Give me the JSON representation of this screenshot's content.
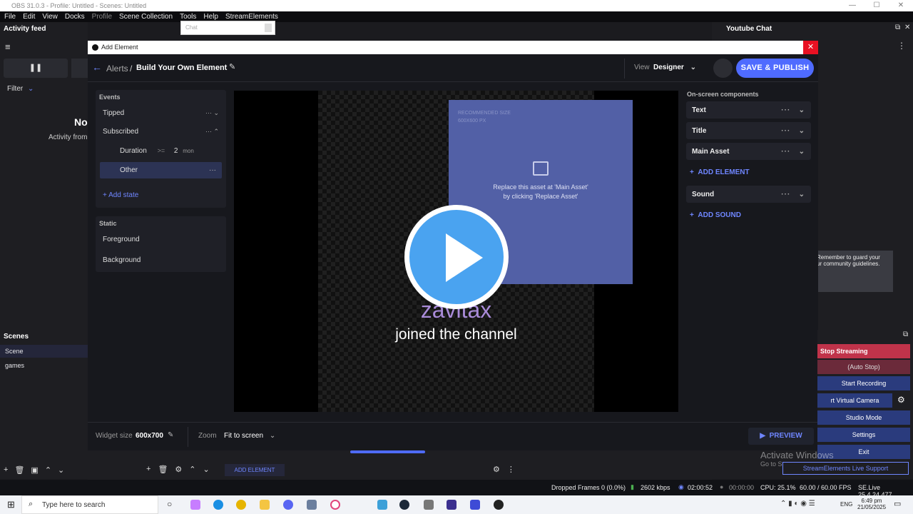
{
  "window": {
    "title": "OBS 31.0.3 - Profile: Untitled - Scenes: Untitled"
  },
  "menu": [
    "File",
    "Edit",
    "View",
    "Docks",
    "Profile",
    "Scene Collection",
    "Tools",
    "Help",
    "StreamElements"
  ],
  "chat_popup": {
    "label": "Chat"
  },
  "activity": {
    "title": "Activity feed",
    "filter": "Filter",
    "empty_title": "No",
    "empty_sub": "Activity from"
  },
  "youtube": {
    "title": "Youtube Chat",
    "notice_line1": "Remember to guard your",
    "notice_line2": "ur community guidelines."
  },
  "modal": {
    "title": "Add Element",
    "breadcrumb_parent": "Alerts",
    "breadcrumb_sep": "/",
    "breadcrumb_current": "Build Your Own Element",
    "view_label": "View",
    "view_value": "Designer",
    "publish": "SAVE & PUBLISH"
  },
  "events": {
    "heading": "Events",
    "items": [
      {
        "label": "Tipped",
        "ctl": "··· ⌄"
      },
      {
        "label": "Subscribed",
        "ctl": "··· ⌃"
      }
    ],
    "duration": {
      "label": "Duration",
      "op": ">=",
      "value": "2",
      "unit": "mon"
    },
    "other": "Other",
    "add_state": "+ Add state",
    "static_heading": "Static",
    "static_items": [
      "Foreground",
      "Background"
    ]
  },
  "canvas": {
    "recommended_line1": "RECOMMENDED SIZE",
    "recommended_line2": "600X600 PX",
    "replace_line1": "Replace this asset at 'Main Asset'",
    "replace_line2": "by clicking 'Replace Asset'",
    "username": "zavitax",
    "message": "joined the channel"
  },
  "components": {
    "heading": "On-screen components",
    "items": [
      "Text",
      "Title",
      "Main Asset"
    ],
    "add_element": "ADD ELEMENT",
    "sound": "Sound",
    "add_sound": "ADD SOUND"
  },
  "footer": {
    "widget_size_label": "Widget size",
    "widget_size_value": "600x700",
    "zoom_label": "Zoom",
    "zoom_value": "Fit to screen",
    "preview": "PREVIEW"
  },
  "scenes": {
    "title": "Scenes",
    "items": [
      "Scene",
      "games"
    ]
  },
  "sources_toolbar": {
    "add_element": "ADD ELEMENT"
  },
  "controls": {
    "stop_streaming": "Stop Streaming",
    "auto_stop": "(Auto Stop)",
    "start_recording": "Start Recording",
    "virtual_camera": "rt Virtual Camera",
    "studio_mode": "Studio Mode",
    "settings": "Settings",
    "exit": "Exit",
    "support": "StreamElements Live Support"
  },
  "watermark": {
    "line1": "Activate Windows",
    "line2": "Go to Settings to activate Windows."
  },
  "status": {
    "dropped": "Dropped Frames 0 (0.0%)",
    "kbps": "2602 kbps",
    "stream_time": "02:00:52",
    "rec_time": "00:00:00",
    "cpu": "CPU: 25.1%",
    "fps": "60.00 / 60.00 FPS",
    "version": "SE.Live 25.4.24.477"
  },
  "taskbar": {
    "search_placeholder": "Type here to search",
    "time": "6:49 pm",
    "date": "21/05/2025",
    "lang": "ENG"
  },
  "colors": {
    "accent": "#4f6bff",
    "stop": "#c0334a",
    "asset": "#5260a6",
    "username": "#a98bd8"
  }
}
